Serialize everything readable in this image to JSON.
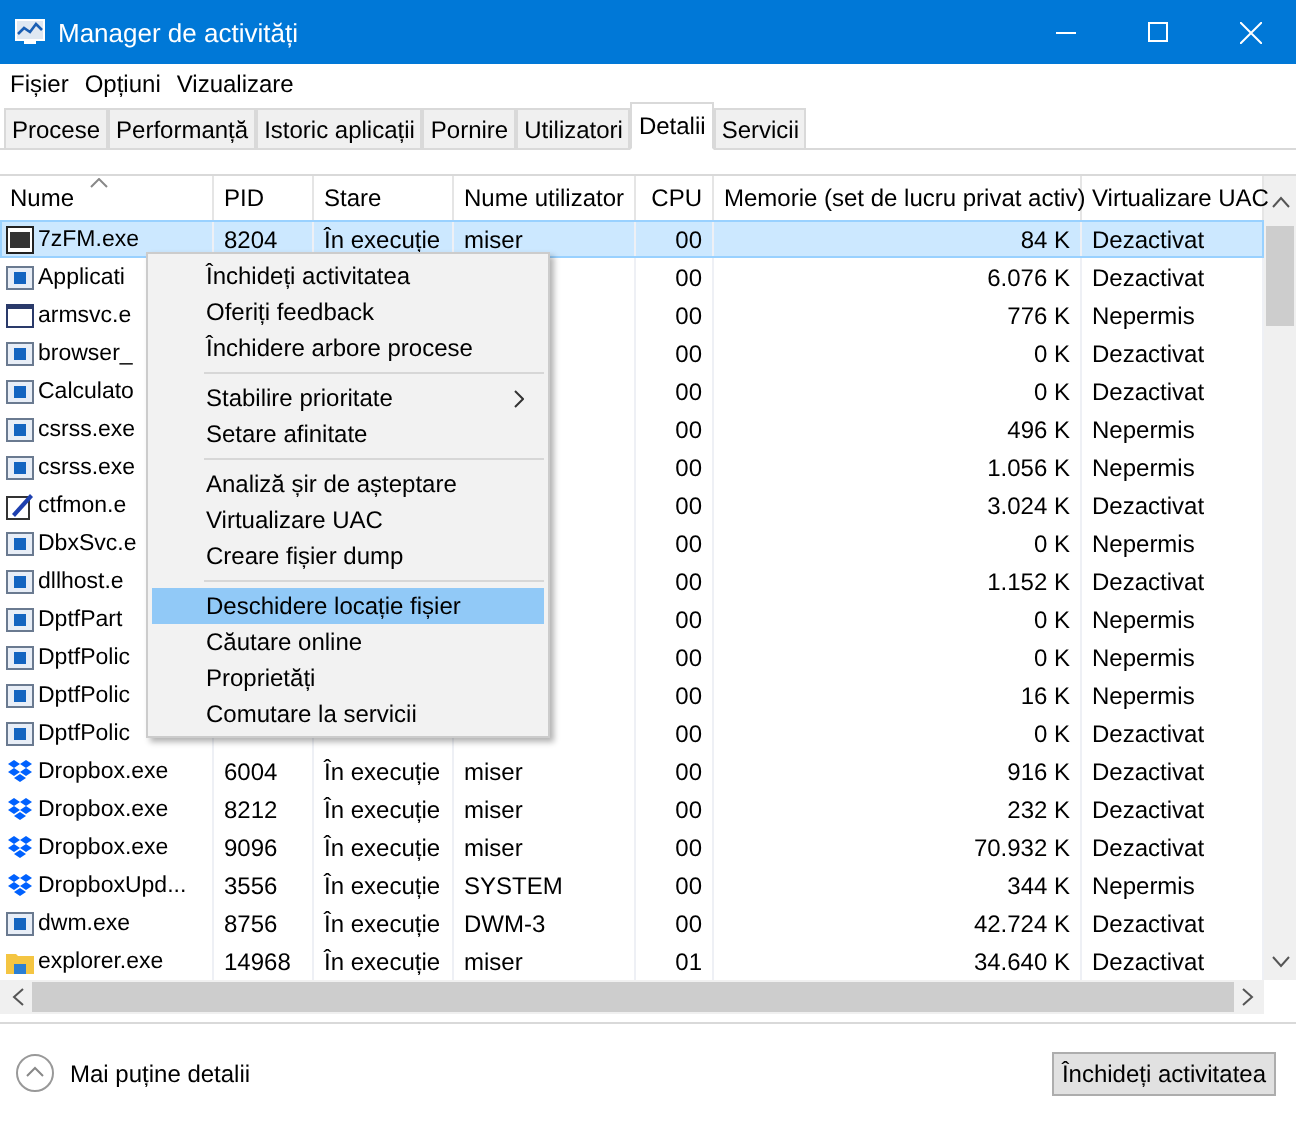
{
  "window": {
    "title": "Manager de activități"
  },
  "menu": [
    "Fișier",
    "Opțiuni",
    "Vizualizare"
  ],
  "tabs": [
    {
      "label": "Procese",
      "selected": false
    },
    {
      "label": "Performanță",
      "selected": false
    },
    {
      "label": "Istoric aplicații",
      "selected": false
    },
    {
      "label": "Pornire",
      "selected": false
    },
    {
      "label": "Utilizatori",
      "selected": false
    },
    {
      "label": "Detalii",
      "selected": true
    },
    {
      "label": "Servicii",
      "selected": false
    }
  ],
  "table": {
    "columns": [
      "Nume",
      "PID",
      "Stare",
      "Nume utilizator",
      "CPU",
      "Memorie (set de lucru privat activ)",
      "Virtualizare UAC"
    ],
    "rows": [
      {
        "kind": "archive",
        "name": "7zFM.exe",
        "pid": "8204",
        "status": "În execuție",
        "user": "miser",
        "cpu": "00",
        "memory": "84 K",
        "uac": "Dezactivat",
        "selected": true
      },
      {
        "kind": "app",
        "name": "Applicati",
        "cpu": "00",
        "memory": "6.076 K",
        "uac": "Dezactivat",
        "selected": false
      },
      {
        "kind": "window",
        "name": "armsvc.e",
        "cpu": "00",
        "memory": "776 K",
        "uac": "Nepermis",
        "selected": false
      },
      {
        "kind": "app",
        "name": "browser_",
        "cpu": "00",
        "memory": "0 K",
        "uac": "Dezactivat",
        "selected": false
      },
      {
        "kind": "app",
        "name": "Calculato",
        "cpu": "00",
        "memory": "0 K",
        "uac": "Dezactivat",
        "selected": false
      },
      {
        "kind": "app",
        "name": "csrss.exe",
        "cpu": "00",
        "memory": "496 K",
        "uac": "Nepermis",
        "selected": false
      },
      {
        "kind": "app",
        "name": "csrss.exe",
        "cpu": "00",
        "memory": "1.056 K",
        "uac": "Nepermis",
        "selected": false
      },
      {
        "kind": "pen",
        "name": "ctfmon.e",
        "cpu": "00",
        "memory": "3.024 K",
        "uac": "Dezactivat",
        "selected": false
      },
      {
        "kind": "app",
        "name": "DbxSvc.e",
        "cpu": "00",
        "memory": "0 K",
        "uac": "Nepermis",
        "selected": false
      },
      {
        "kind": "app",
        "name": "dllhost.e",
        "cpu": "00",
        "memory": "1.152 K",
        "uac": "Dezactivat",
        "selected": false
      },
      {
        "kind": "app",
        "name": "DptfPart",
        "cpu": "00",
        "memory": "0 K",
        "uac": "Nepermis",
        "selected": false
      },
      {
        "kind": "app",
        "name": "DptfPolic",
        "cpu": "00",
        "memory": "0 K",
        "uac": "Nepermis",
        "selected": false
      },
      {
        "kind": "app",
        "name": "DptfPolic",
        "cpu": "00",
        "memory": "16 K",
        "uac": "Nepermis",
        "selected": false
      },
      {
        "kind": "app",
        "name": "DptfPolic",
        "cpu": "00",
        "memory": "0 K",
        "uac": "Dezactivat",
        "selected": false
      },
      {
        "kind": "dropbox",
        "name": "Dropbox.exe",
        "pid": "6004",
        "status": "În execuție",
        "user": "miser",
        "cpu": "00",
        "memory": "916 K",
        "uac": "Dezactivat",
        "selected": false
      },
      {
        "kind": "dropbox",
        "name": "Dropbox.exe",
        "pid": "8212",
        "status": "În execuție",
        "user": "miser",
        "cpu": "00",
        "memory": "232 K",
        "uac": "Dezactivat",
        "selected": false
      },
      {
        "kind": "dropbox",
        "name": "Dropbox.exe",
        "pid": "9096",
        "status": "În execuție",
        "user": "miser",
        "cpu": "00",
        "memory": "70.932 K",
        "uac": "Dezactivat",
        "selected": false
      },
      {
        "kind": "dropbox",
        "name": "DropboxUpd...",
        "pid": "3556",
        "status": "În execuție",
        "user": "SYSTEM",
        "cpu": "00",
        "memory": "344 K",
        "uac": "Nepermis",
        "selected": false
      },
      {
        "kind": "app",
        "name": "dwm.exe",
        "pid": "8756",
        "status": "În execuție",
        "user": "DWM-3",
        "cpu": "00",
        "memory": "42.724 K",
        "uac": "Dezactivat",
        "selected": false
      },
      {
        "kind": "folder",
        "name": "explorer.exe",
        "pid": "14968",
        "status": "În execuție",
        "user": "miser",
        "cpu": "01",
        "memory": "34.640 K",
        "uac": "Dezactivat",
        "selected": false
      }
    ]
  },
  "context_menu": {
    "items": [
      {
        "kind": "item",
        "label": "Închideți activitatea",
        "selected": false
      },
      {
        "kind": "item",
        "label": "Oferiți feedback",
        "selected": false
      },
      {
        "kind": "item",
        "label": "Închidere arbore procese",
        "selected": false
      },
      {
        "kind": "separator"
      },
      {
        "kind": "submenu",
        "label": "Stabilire prioritate",
        "selected": false
      },
      {
        "kind": "item",
        "label": "Setare afinitate",
        "selected": false
      },
      {
        "kind": "separator"
      },
      {
        "kind": "item",
        "label": "Analiză șir de așteptare",
        "selected": false
      },
      {
        "kind": "item",
        "label": "Virtualizare UAC",
        "selected": false
      },
      {
        "kind": "item",
        "label": "Creare fișier dump",
        "selected": false
      },
      {
        "kind": "separator"
      },
      {
        "kind": "item",
        "label": "Deschidere locație fișier",
        "selected": true
      },
      {
        "kind": "item",
        "label": "Căutare online",
        "selected": false
      },
      {
        "kind": "item",
        "label": "Proprietăți",
        "selected": false
      },
      {
        "kind": "item",
        "label": "Comutare la servicii",
        "selected": false
      }
    ]
  },
  "footer": {
    "toggle": "Mai puține detalii",
    "button": "Închideți activitatea"
  }
}
